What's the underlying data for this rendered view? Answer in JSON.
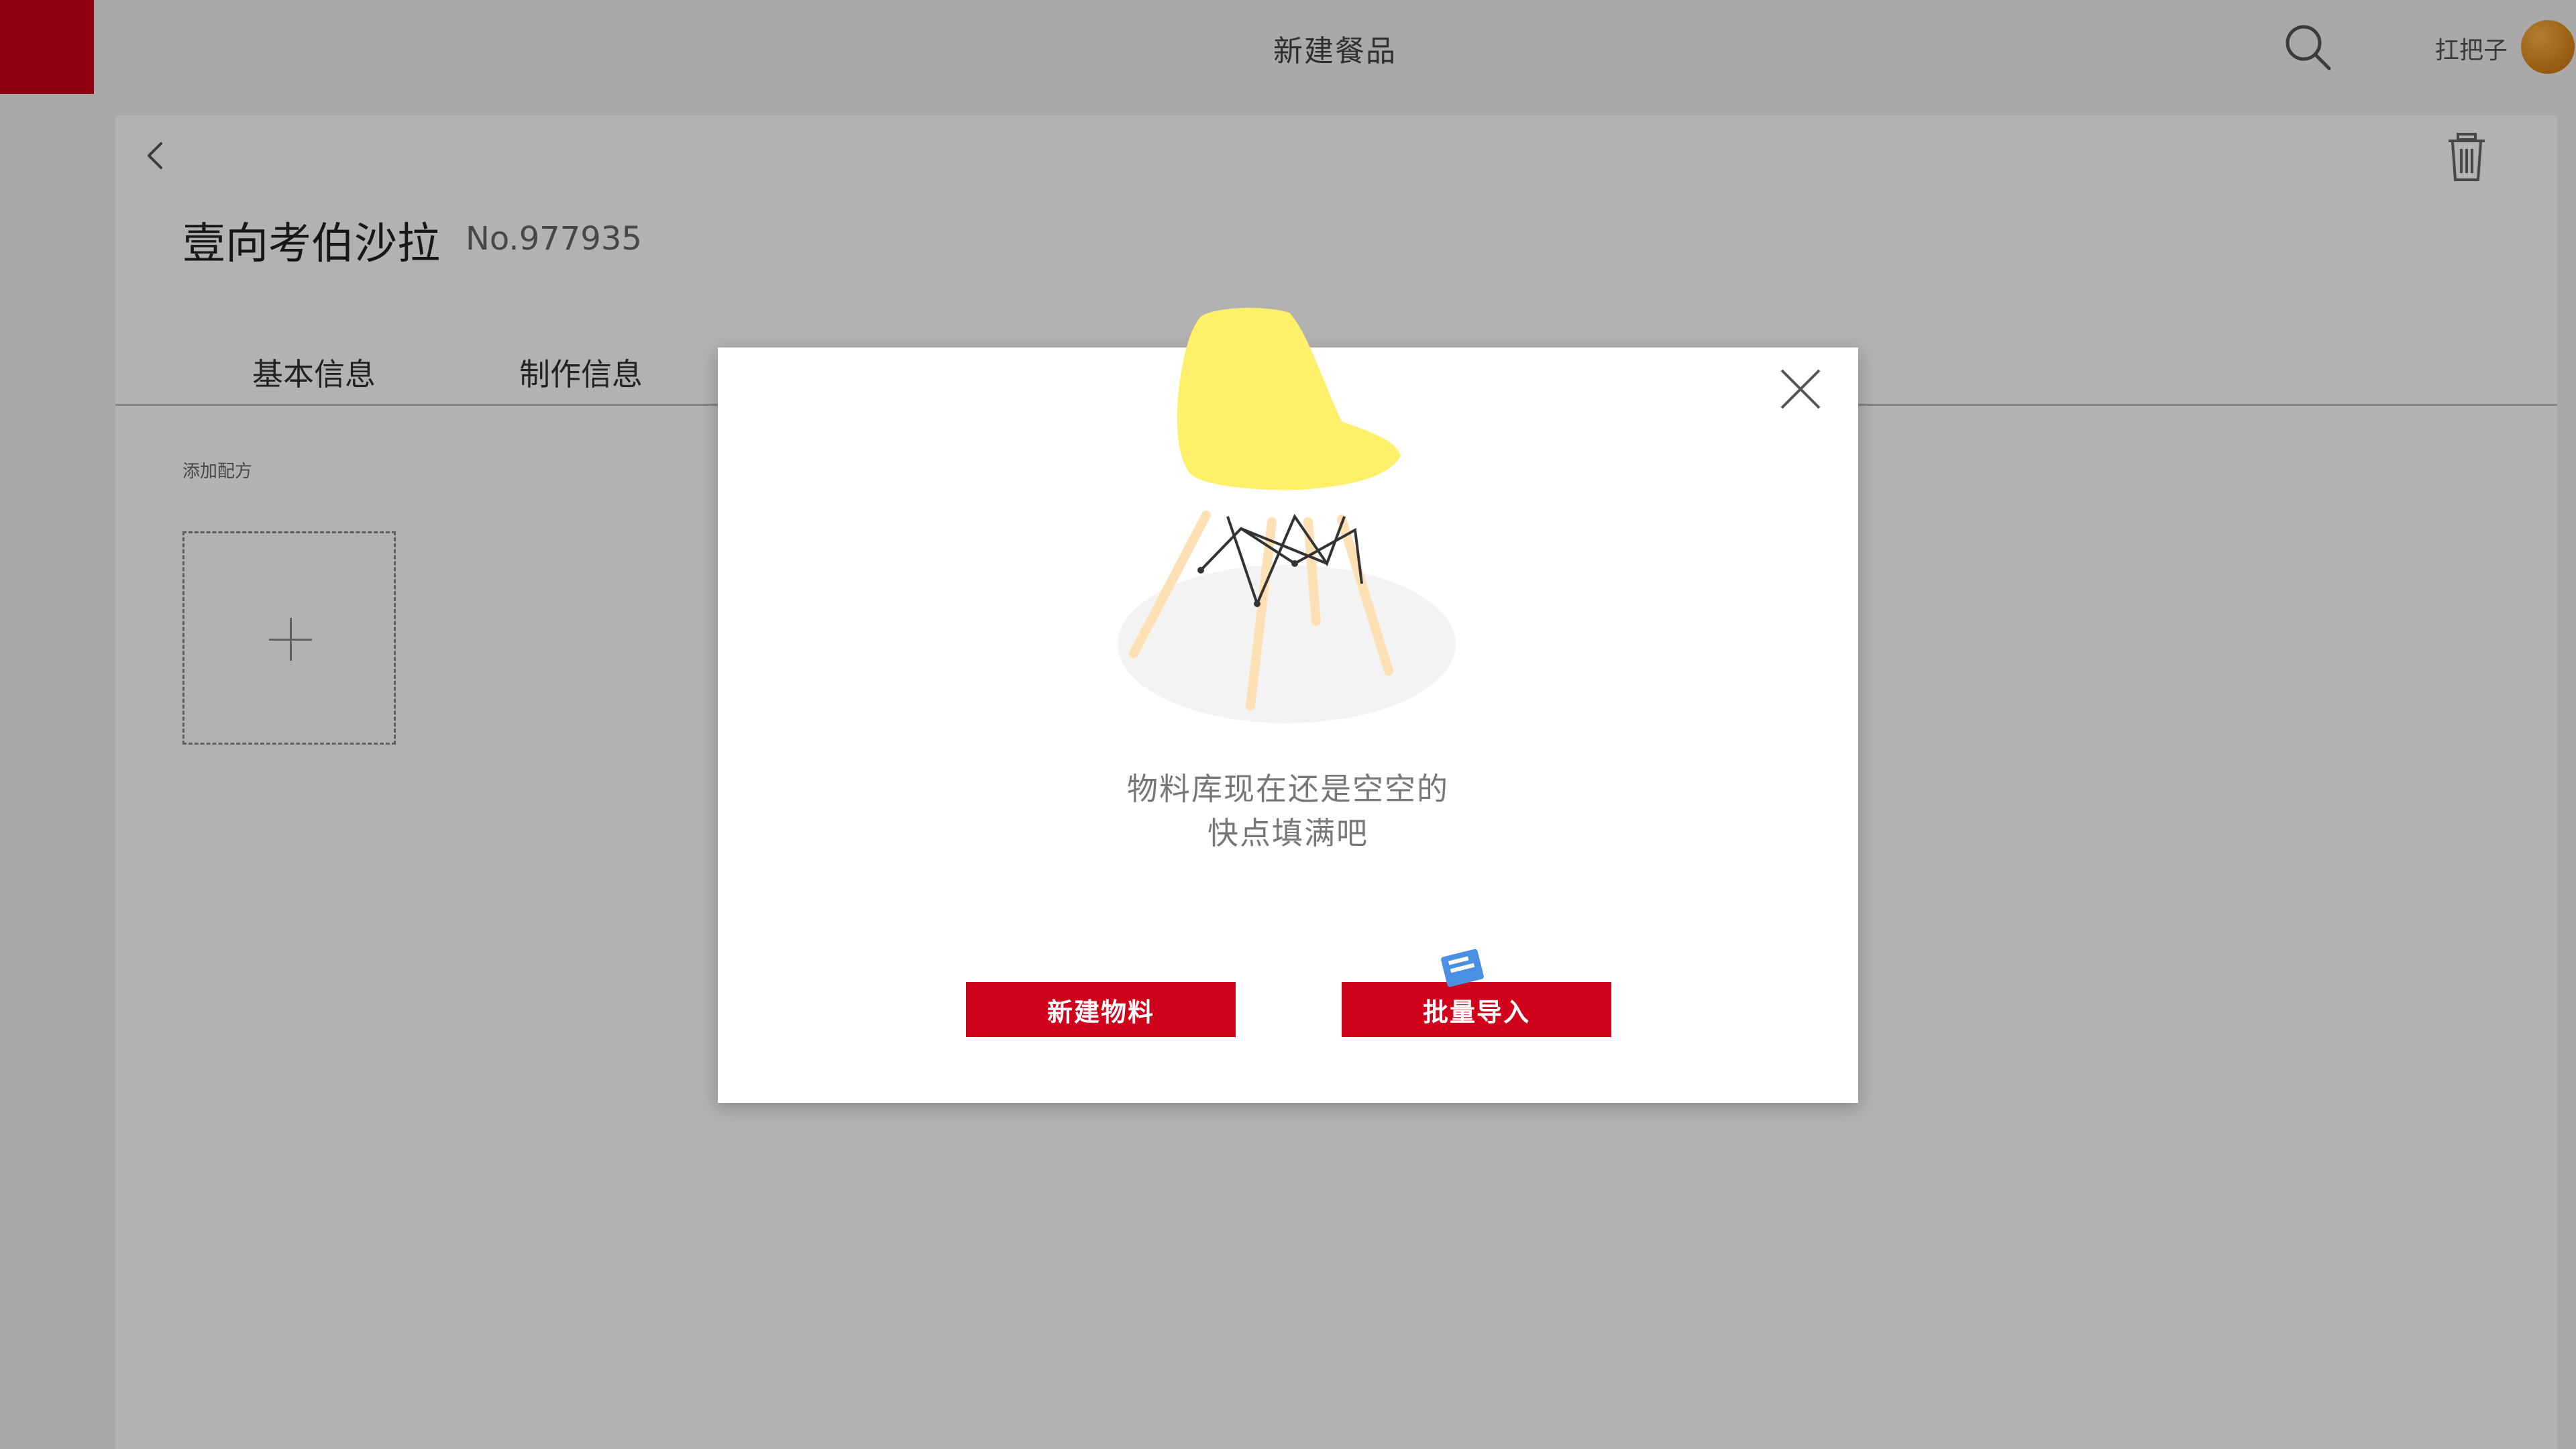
{
  "header": {
    "title": "新建餐品",
    "user_name": "扛把子",
    "brand_color": "#d0021b"
  },
  "icons": {
    "search": "search-icon",
    "back": "chevron-left-icon",
    "trash": "trash-icon",
    "close": "close-icon",
    "plus": "plus-icon",
    "import": "document-icon"
  },
  "dish": {
    "name": "壹向考伯沙拉",
    "number": "No.977935"
  },
  "tabs": [
    {
      "label": "基本信息"
    },
    {
      "label": "制作信息"
    }
  ],
  "recipe": {
    "add_label": "添加配方"
  },
  "modal": {
    "empty_line1": "物料库现在还是空空的",
    "empty_line2": "快点填满吧",
    "new_material_button": "新建物料",
    "bulk_import_button": "批量导入",
    "accent_color": "#d0021b",
    "chair_color": "#fff069"
  }
}
